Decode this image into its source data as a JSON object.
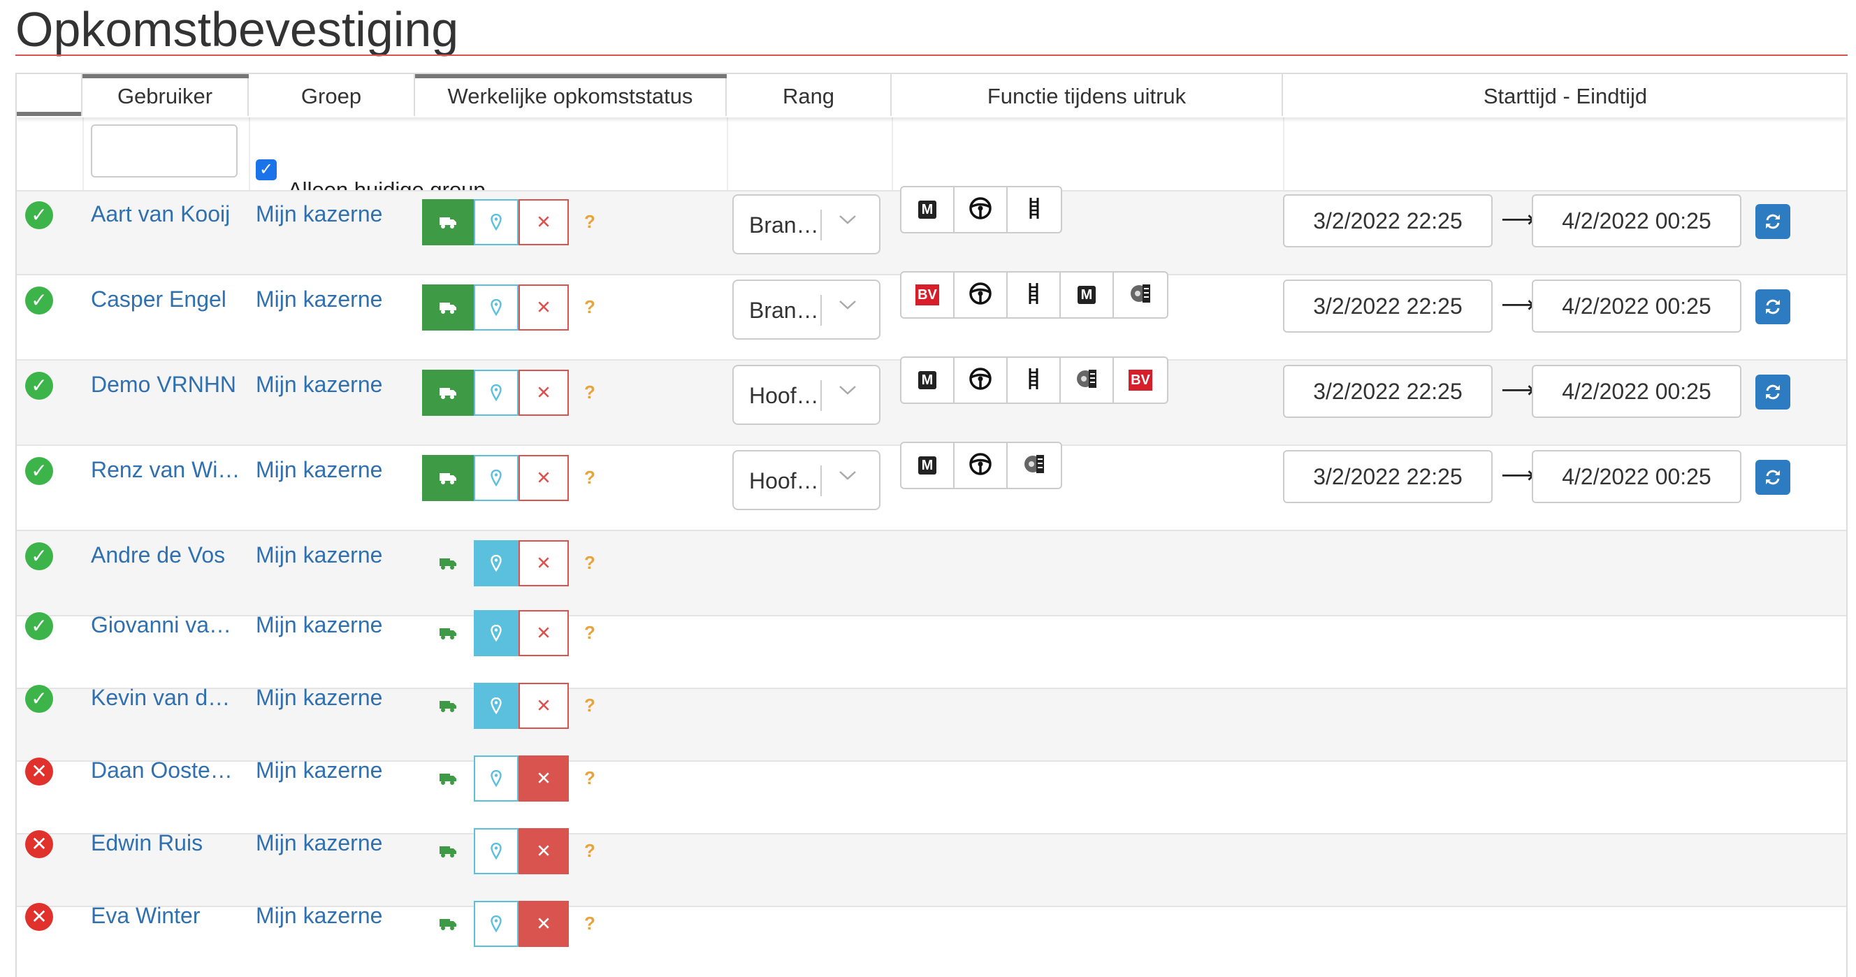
{
  "page_title": "Opkomstbevestiging",
  "columns": {
    "gebruiker": "Gebruiker",
    "groep": "Groep",
    "status": "Werkelijke opkomststatus",
    "rang": "Rang",
    "functie": "Functie tijdens uitruk",
    "tijd": "Starttijd - Eindtijd"
  },
  "filter": {
    "user_placeholder": "",
    "only_current_group_label": "Alleen huidige group",
    "only_current_group_checked": true
  },
  "status_question_mark": "?",
  "colors": {
    "accent_red": "#d9534f",
    "ok_green": "#3cb44a",
    "link_blue": "#2f70b1",
    "info_blue": "#5bc0de",
    "primary_blue": "#2d7cc1"
  },
  "rows": [
    {
      "ok": true,
      "name": "Aart van Kooij",
      "group": "Mijn kazerne",
      "state": "truck",
      "rank": "Bran…",
      "functions": [
        "M",
        "steering",
        "ladder"
      ],
      "start": "3/2/2022 22:25",
      "end": "4/2/2022 00:25"
    },
    {
      "ok": true,
      "name": "Casper Engel",
      "group": "Mijn kazerne",
      "state": "truck",
      "rank": "Bran…",
      "functions": [
        "BV",
        "steering",
        "ladder",
        "M",
        "pump"
      ],
      "start": "3/2/2022 22:25",
      "end": "4/2/2022 00:25"
    },
    {
      "ok": true,
      "name": "Demo VRNHN",
      "group": "Mijn kazerne",
      "state": "truck",
      "rank": "Hoof…",
      "functions": [
        "M",
        "steering",
        "ladder",
        "pump",
        "BV"
      ],
      "start": "3/2/2022 22:25",
      "end": "4/2/2022 00:25"
    },
    {
      "ok": true,
      "name": "Renz van Wi…",
      "group": "Mijn kazerne",
      "state": "truck",
      "rank": "Hoof…",
      "functions": [
        "M",
        "steering",
        "pump"
      ],
      "start": "3/2/2022 22:25",
      "end": "4/2/2022 00:25"
    },
    {
      "ok": true,
      "name": "Andre de Vos",
      "group": "Mijn kazerne",
      "state": "location"
    },
    {
      "ok": true,
      "name": "Giovanni va…",
      "group": "Mijn kazerne",
      "state": "location"
    },
    {
      "ok": true,
      "name": "Kevin van d…",
      "group": "Mijn kazerne",
      "state": "location"
    },
    {
      "ok": false,
      "name": "Daan Ooste…",
      "group": "Mijn kazerne",
      "state": "absent"
    },
    {
      "ok": false,
      "name": "Edwin Ruis",
      "group": "Mijn kazerne",
      "state": "absent"
    },
    {
      "ok": false,
      "name": "Eva Winter",
      "group": "Mijn kazerne",
      "state": "absent"
    }
  ]
}
